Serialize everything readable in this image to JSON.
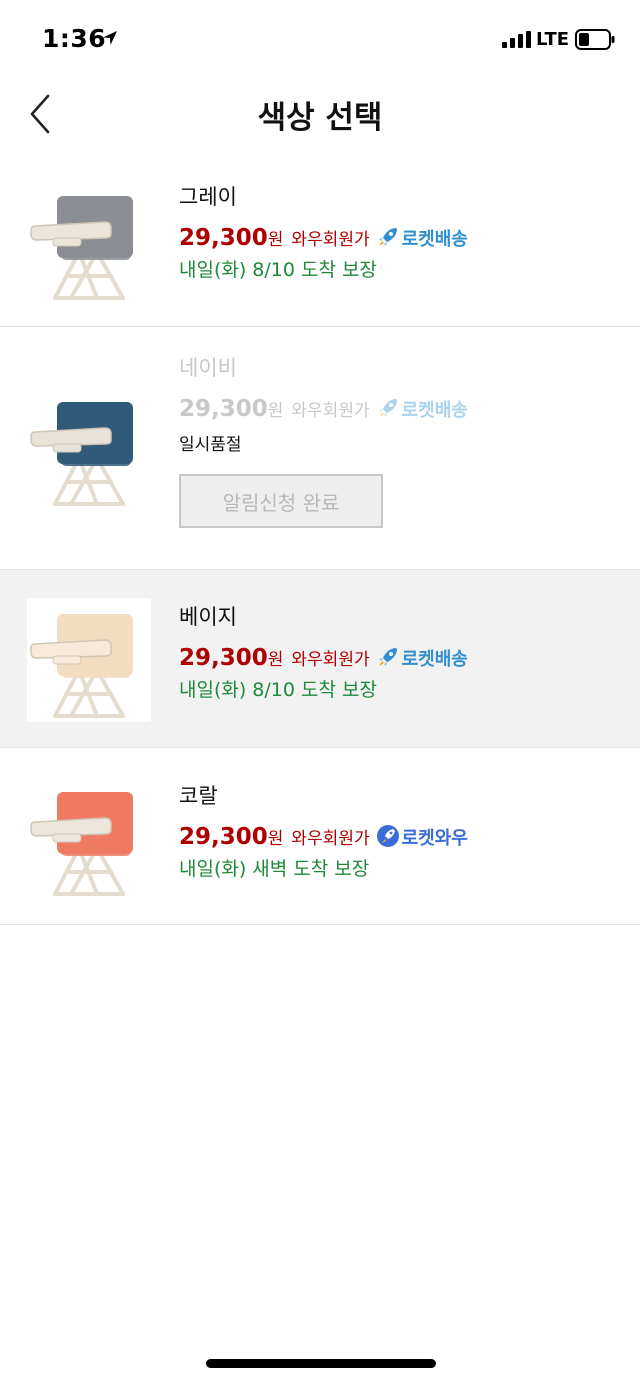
{
  "status_bar": {
    "time": "1:36",
    "network": "LTE"
  },
  "page": {
    "title": "색상 선택"
  },
  "options": [
    {
      "name": "그레이",
      "price": "29,300",
      "currency": "원",
      "member_label": "와우회원가",
      "badge": "로켓배송",
      "badge_icon": "rocket-icon",
      "delivery": "내일(화) 8/10 도착 보장",
      "chair_color": "#8b8e92",
      "tray_color": "#ece5da"
    },
    {
      "name": "네이비",
      "price": "29,300",
      "currency": "원",
      "member_label": "와우회원가",
      "badge": "로켓배송",
      "badge_icon": "rocket-icon",
      "stock_status": "일시품절",
      "notify_button": "알림신청 완료",
      "chair_color": "#2f5b78",
      "tray_color": "#e9e2d6"
    },
    {
      "name": "베이지",
      "price": "29,300",
      "currency": "원",
      "member_label": "와우회원가",
      "badge": "로켓배송",
      "badge_icon": "rocket-icon",
      "delivery": "내일(화) 8/10 도착 보장",
      "chair_color": "#f3dcbf",
      "tray_color": "#f7ead8"
    },
    {
      "name": "코랄",
      "price": "29,300",
      "currency": "원",
      "member_label": "와우회원가",
      "badge": "로켓와우",
      "badge_icon": "rocket-wow-icon",
      "delivery": "내일(화) 새벽 도착 보장",
      "chair_color": "#f07a62",
      "tray_color": "#ece6dc"
    }
  ],
  "colors": {
    "price_red": "#ae0000",
    "delivery_green": "#1f8a3a",
    "rocket_blue": "#2f8fd0",
    "selected_row_bg": "#f2f2f2",
    "divider": "#e4e4e4"
  }
}
